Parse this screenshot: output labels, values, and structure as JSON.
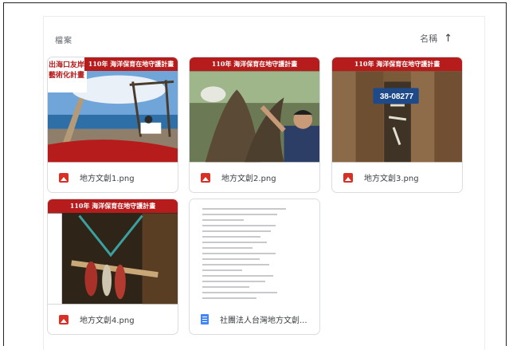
{
  "header": {
    "title": "檔案",
    "sort_label": "名稱",
    "sort_icon": "arrow-up-icon"
  },
  "files": [
    {
      "name": "地方文創1.png",
      "type": "image",
      "banner_left": "出海口友岸灘\n藝術化計畫",
      "banner_right": "110年 海洋保育在地守護計畫"
    },
    {
      "name": "地方文創2.png",
      "type": "image",
      "banner": "110年 海洋保育在地守護計畫"
    },
    {
      "name": "地方文創3.png",
      "type": "image",
      "banner": "110年 海洋保育在地守護計畫",
      "sign_text": "38-08277"
    },
    {
      "name": "地方文創4.png",
      "type": "image",
      "banner": "110年 海洋保育在地守護計畫"
    },
    {
      "name": "社團法人台灣地方文創...",
      "type": "document"
    }
  ],
  "colors": {
    "banner_red": "#b71c1c",
    "image_icon": "#d93025",
    "doc_icon": "#4285f4"
  }
}
